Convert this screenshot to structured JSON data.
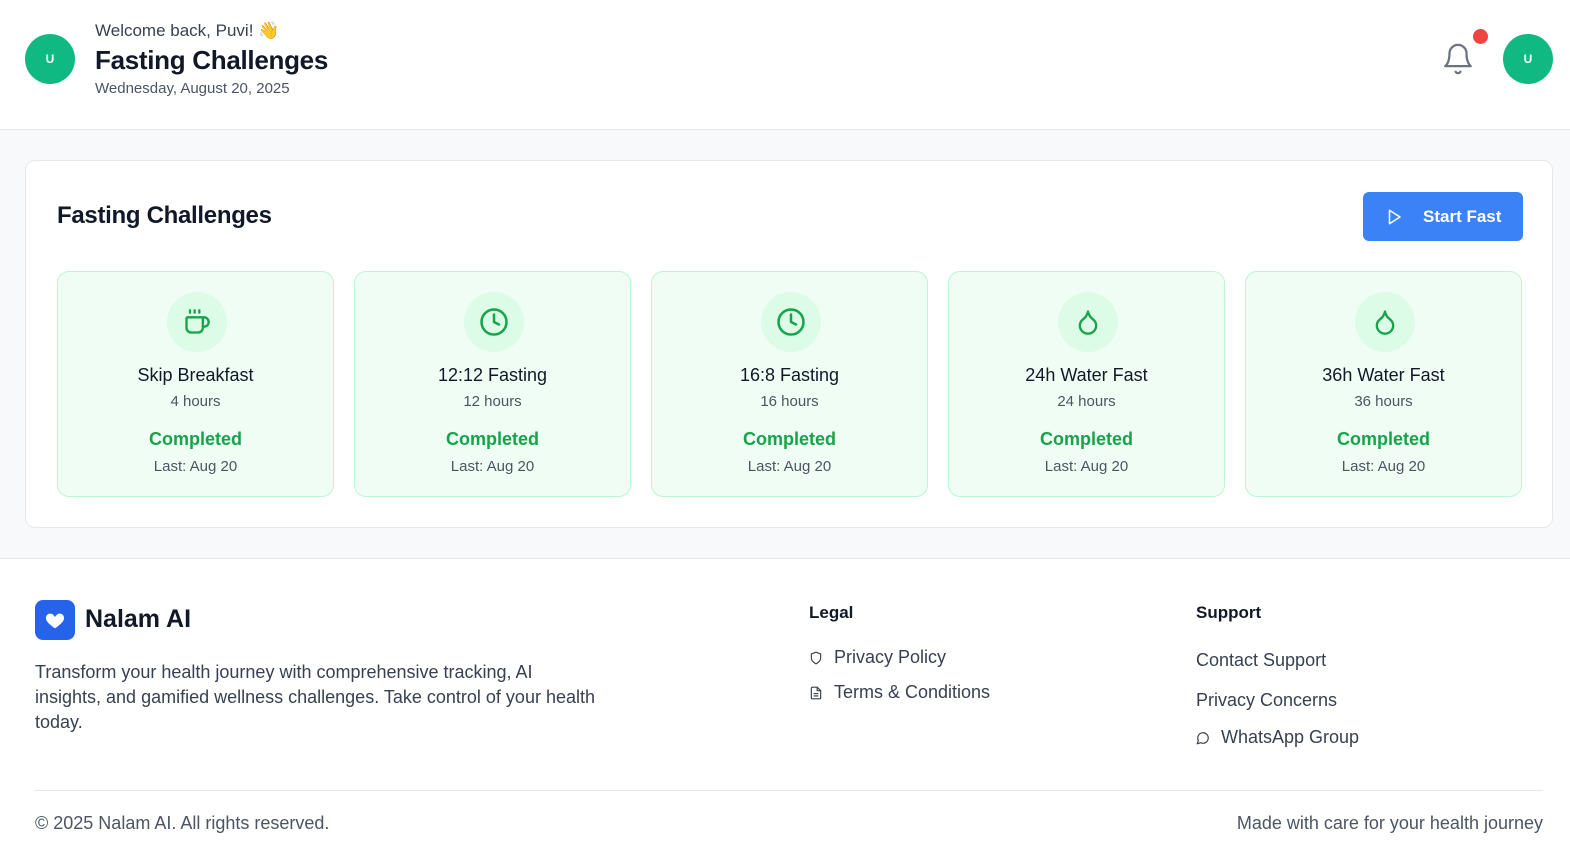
{
  "header": {
    "avatar_initial": "U",
    "welcome": "Welcome back, Puvi! 👋",
    "title": "Fasting Challenges",
    "date": "Wednesday, August 20, 2025",
    "profile_initial": "U"
  },
  "challenges_card": {
    "title": "Fasting Challenges",
    "start_button": "Start Fast",
    "items": [
      {
        "icon": "coffee-icon",
        "name": "Skip Breakfast",
        "hours": "4 hours",
        "status": "Completed",
        "last": "Last: Aug 20"
      },
      {
        "icon": "clock-icon",
        "name": "12:12 Fasting",
        "hours": "12 hours",
        "status": "Completed",
        "last": "Last: Aug 20"
      },
      {
        "icon": "clock-icon",
        "name": "16:8 Fasting",
        "hours": "16 hours",
        "status": "Completed",
        "last": "Last: Aug 20"
      },
      {
        "icon": "droplet-icon",
        "name": "24h Water Fast",
        "hours": "24 hours",
        "status": "Completed",
        "last": "Last: Aug 20"
      },
      {
        "icon": "droplet-icon",
        "name": "36h Water Fast",
        "hours": "36 hours",
        "status": "Completed",
        "last": "Last: Aug 20"
      }
    ]
  },
  "footer": {
    "brand": "Nalam AI",
    "description": "Transform your health journey with comprehensive tracking, AI insights, and gamified wellness challenges. Take control of your health today.",
    "legal": {
      "heading": "Legal",
      "links": [
        "Privacy Policy",
        "Terms & Conditions"
      ]
    },
    "support": {
      "heading": "Support",
      "links": [
        "Contact Support",
        "Privacy Concerns",
        "WhatsApp Group"
      ]
    },
    "copyright": "© 2025 Nalam AI. All rights reserved.",
    "tagline": "Made with care for your health journey"
  },
  "colors": {
    "primary_blue": "#3b82f6",
    "brand_blue": "#2563eb",
    "avatar_green": "#10b981",
    "completed_green": "#16a34a",
    "notification_red": "#ef4444"
  }
}
